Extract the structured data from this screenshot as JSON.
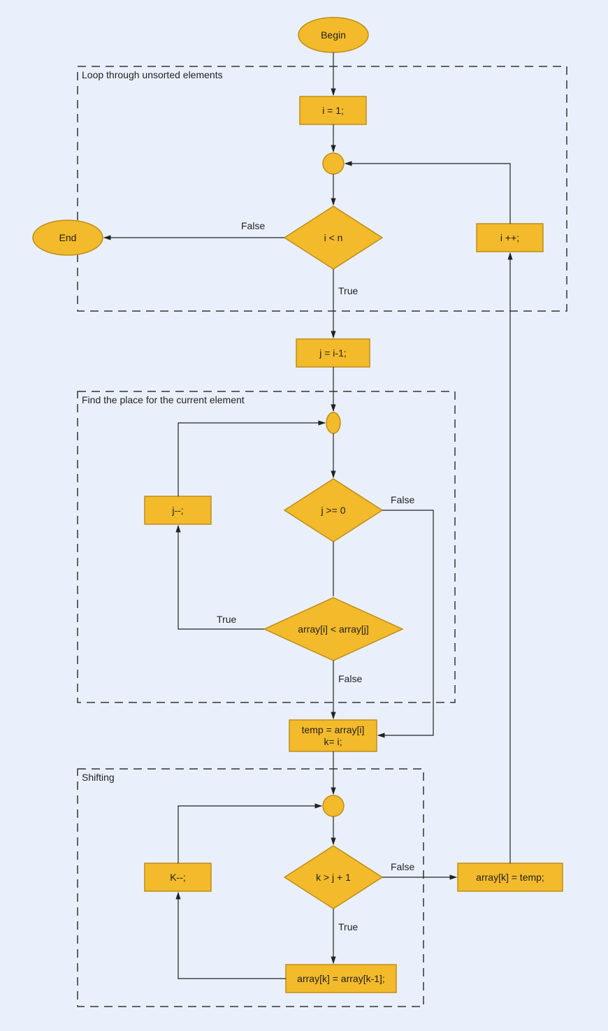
{
  "nodes": {
    "begin": "Begin",
    "end": "End",
    "i_init": "i = 1;",
    "i_cond": "i < n",
    "i_inc": "i ++;",
    "j_init": "j = i-1;",
    "j_cond": "j >= 0",
    "arr_cond": "array[i] < array[j]",
    "j_dec": "j--;",
    "temp": "temp = array[i]\nk= i;",
    "k_cond": "k > j + 1",
    "k_dec": "K--;",
    "arr_shift": "array[k] = array[k-1];",
    "arr_assign": "array[k] = temp;"
  },
  "groups": {
    "g1": "Loop through unsorted elements",
    "g2": "Find the place for the current element",
    "g3": "Shifting"
  },
  "labels": {
    "true": "True",
    "false": "False"
  }
}
